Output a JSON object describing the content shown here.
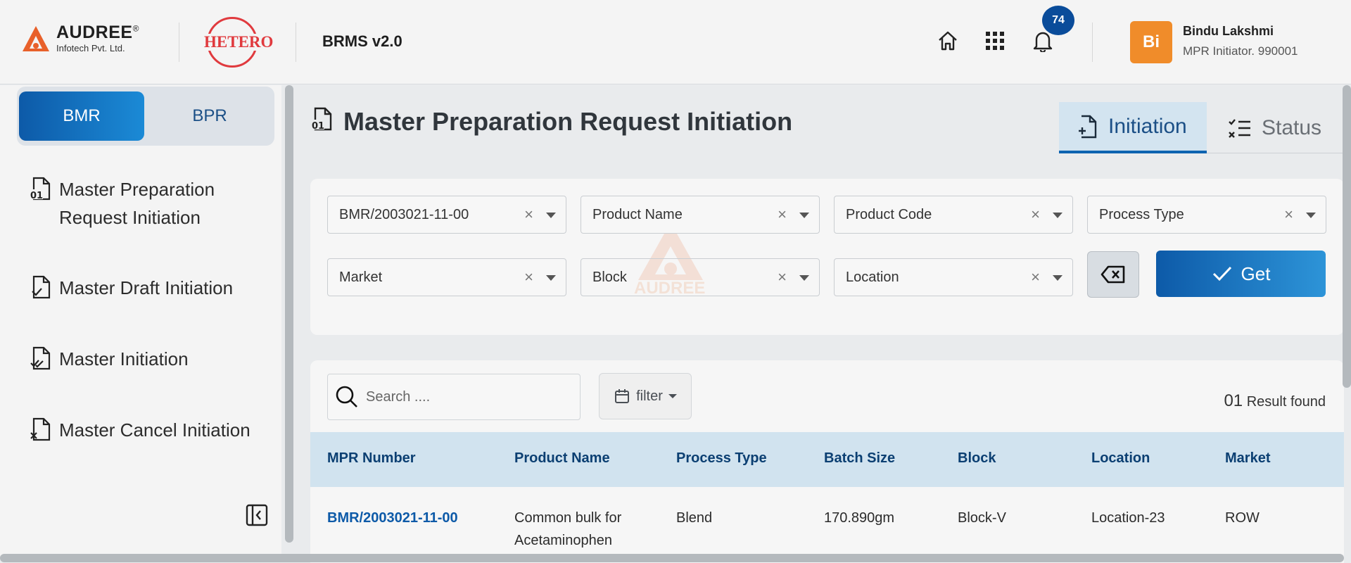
{
  "header": {
    "company_brand": "AUDREE",
    "company_sub": "Infotech Pvt. Ltd.",
    "client_logo": "HETERO",
    "app_title": "BRMS v2.0",
    "notification_count": "74",
    "user": {
      "initials": "Bi",
      "name": "Bindu Lakshmi",
      "role": "MPR Initiator. 990001"
    },
    "icons": [
      "home-icon",
      "apps-grid-icon",
      "bell-icon"
    ]
  },
  "sidebar": {
    "segments": [
      "BMR",
      "BPR"
    ],
    "active_segment": "BMR",
    "items": [
      {
        "line1": "Master Preparation",
        "line2": "Request Initiation",
        "icon": "doc-01-icon"
      },
      {
        "label": "Master Draft Initiation",
        "icon": "doc-check-icon"
      },
      {
        "label": "Master Initiation",
        "icon": "doc-double-check-icon"
      },
      {
        "label": "Master Cancel Initiation",
        "icon": "doc-cancel-icon"
      }
    ]
  },
  "main": {
    "page_title": "Master Preparation Request Initiation",
    "tabs": [
      {
        "label": "Initiation",
        "active": true
      },
      {
        "label": "Status",
        "active": false
      }
    ],
    "filters": {
      "mpr_number": "BMR/2003021-11-00",
      "product_name": "Product Name",
      "product_code": "Product Code",
      "process_type": "Process Type",
      "market": "Market",
      "block": "Block",
      "location": "Location",
      "get_label": "Get"
    },
    "watermark_text": "AUDREE",
    "search_placeholder": "Search ....",
    "filter_label": "filter",
    "result_count": "01",
    "result_label": "Result found",
    "table": {
      "columns": [
        "MPR Number",
        "Product Name",
        "Process Type",
        "Batch Size",
        "Block",
        "Location",
        "Market"
      ],
      "rows": [
        {
          "mpr_number": "BMR/2003021-11-00",
          "product_name_l1": "Common bulk for",
          "product_name_l2": "Acetaminophen",
          "process_type": "Blend",
          "batch_size": "170.890gm",
          "block": "Block-V",
          "location": "Location-23",
          "market": "ROW"
        }
      ]
    }
  },
  "colors": {
    "primary": "#0d5aa8",
    "accent_orange": "#f08c2a",
    "hetero_red": "#e03a3e",
    "table_header_bg": "#d1e3ef"
  }
}
